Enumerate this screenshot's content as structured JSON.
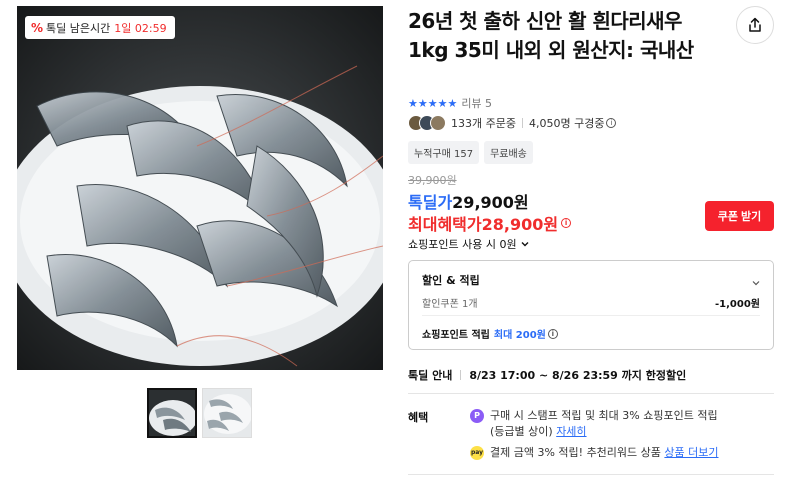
{
  "deal_badge": {
    "icon": "percent-icon",
    "label": "톡딜 남은시간",
    "time": "1일 02:59"
  },
  "product": {
    "title": "26년 첫 출하 신안 활 흰다리새우 1kg 35미 내외 외 원산지: 국내산",
    "rating_stars": "★★★★★",
    "review_label": "리뷰 5",
    "orders": "133개 주문중",
    "subscribers": "4,050명 구경중",
    "tags": [
      "누적구매 157",
      "무료배송"
    ]
  },
  "price": {
    "original": "39,900원",
    "deal_label": "톡딜가",
    "deal_value": "29,900원",
    "max_label": "최대혜택가",
    "max_value": "28,900원",
    "coupon_button": "쿠폰 받기",
    "point_use": "쇼핑포인트 사용 시",
    "point_use_value": "0원"
  },
  "discount_box": {
    "title": "할인 & 적립",
    "coupon_label": "할인쿠폰 1개",
    "coupon_value": "-1,000원",
    "point_label": "쇼핑포인트 적립",
    "point_value": "최대 200원"
  },
  "deal_info": {
    "label": "톡딜 안내",
    "text": "8/23 17:00 ~ 8/26 23:59 까지 한정할인"
  },
  "benefits": {
    "label": "혜택",
    "items": [
      {
        "icon": "P",
        "line1": "구매 시 스탬프 적립 및 최대 3% 쇼핑포인트 적립",
        "line2": "(등급별 상이)",
        "link": "자세히"
      },
      {
        "icon": "pay",
        "line1": "결제 금액 3% 적립! 추천리워드 상품",
        "link": "상품 더보기"
      }
    ]
  },
  "colors": {
    "accent_blue": "#2b6cf6",
    "accent_red": "#f02d2d",
    "button_red": "#f5222d"
  }
}
